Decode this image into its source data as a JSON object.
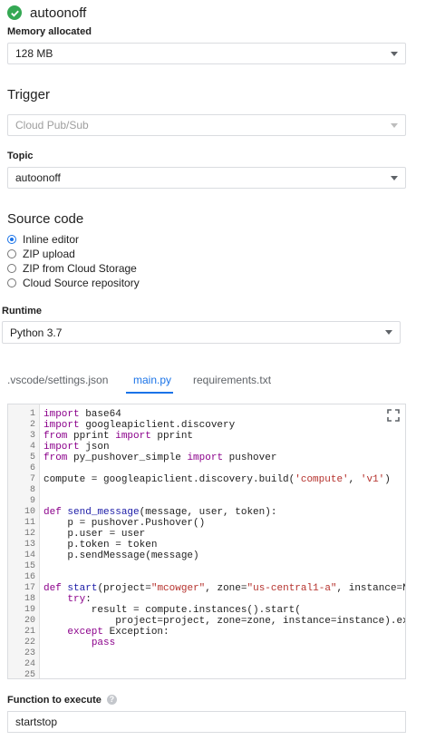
{
  "function": {
    "name": "autoonoff",
    "status_icon": "check-circle-icon",
    "status_color": "#34a853"
  },
  "memory": {
    "label": "Memory allocated",
    "value": "128 MB"
  },
  "trigger": {
    "heading": "Trigger",
    "value": "Cloud Pub/Sub"
  },
  "topic": {
    "label": "Topic",
    "value": "autoonoff"
  },
  "source": {
    "heading": "Source code",
    "options": [
      "Inline editor",
      "ZIP upload",
      "ZIP from Cloud Storage",
      "Cloud Source repository"
    ],
    "selected": "Inline editor"
  },
  "runtime": {
    "label": "Runtime",
    "value": "Python 3.7"
  },
  "tabs": [
    ".vscode/settings.json",
    "main.py",
    "requirements.txt"
  ],
  "active_tab": "main.py",
  "editor": {
    "lines": [
      "import base64",
      "import googleapiclient.discovery",
      "from pprint import pprint",
      "import json",
      "from py_pushover_simple import pushover",
      "",
      "compute = googleapiclient.discovery.build('compute', 'v1')",
      "",
      "",
      "def send_message(message, user, token):",
      "    p = pushover.Pushover()",
      "    p.user = user",
      "    p.token = token",
      "    p.sendMessage(message)",
      "",
      "",
      "def start(project=\"mcowger\", zone=\"us-central1-a\", instance=N",
      "    try:",
      "        result = compute.instances().start(",
      "            project=project, zone=zone, instance=instance).ex",
      "    except Exception:",
      "        pass",
      "",
      "",
      ""
    ]
  },
  "execute": {
    "label": "Function to execute",
    "value": "startstop"
  },
  "colors": {
    "accent": "#1a73e8",
    "border": "#dadce0"
  }
}
